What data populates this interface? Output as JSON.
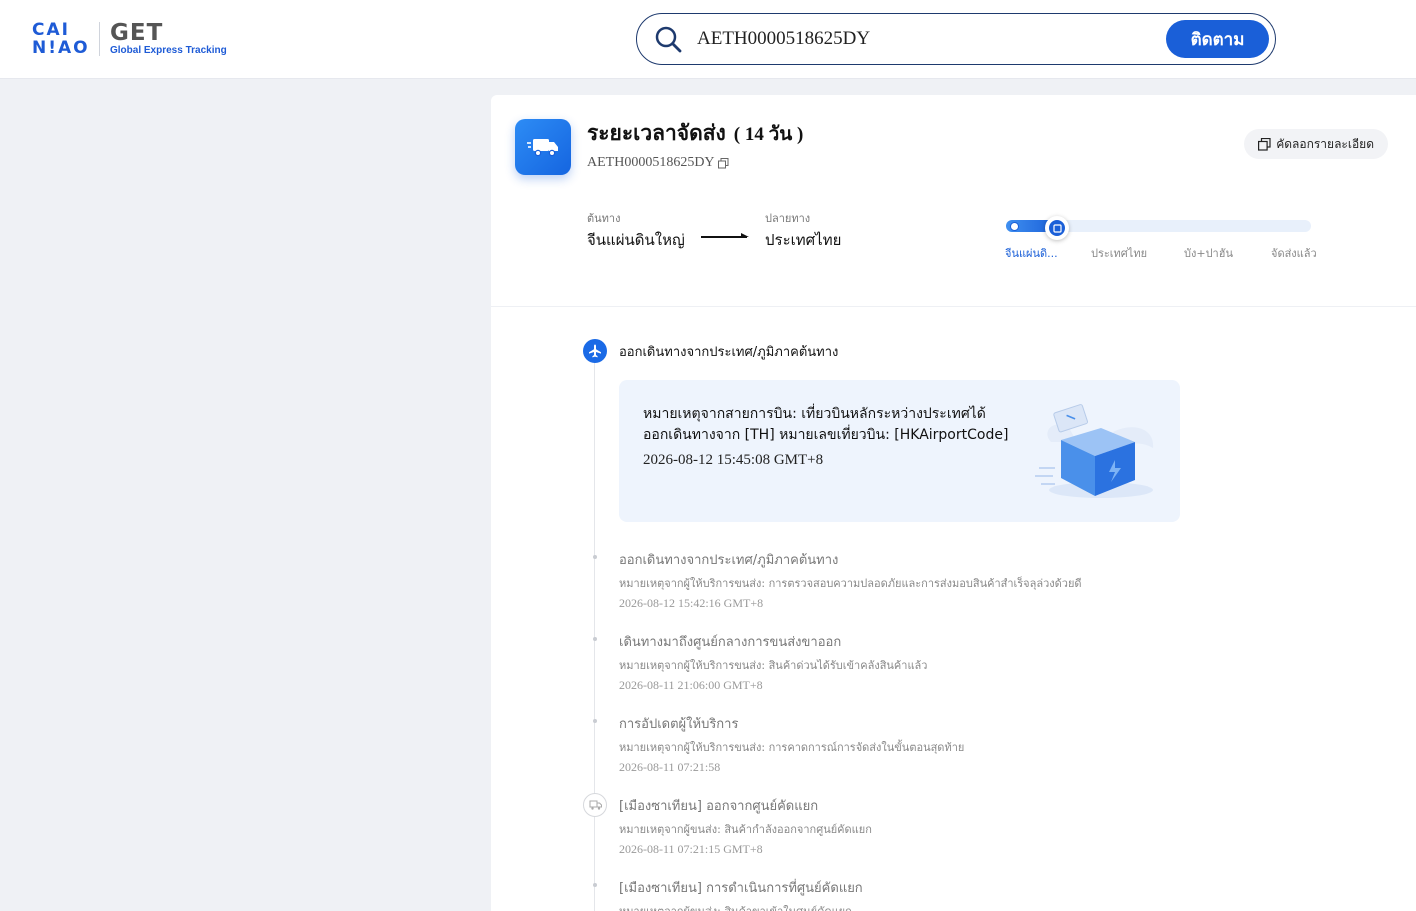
{
  "header": {
    "logo_cainiao": "CAI N!AO",
    "logo_get": "GET",
    "logo_sub": "Global Express Tracking",
    "search_value": "AETH0000518625DY",
    "search_button": "ติดตาม"
  },
  "summary": {
    "title": "ระยะเวลาจัดส่ง",
    "duration": "( 14 วัน )",
    "tracking_number": "AETH0000518625DY",
    "copy_label": "คัดลอกรายละเอียด",
    "origin_label": "ต้นทาง",
    "origin_value": "จีนแผ่นดินใหญ่",
    "dest_label": "ปลายทาง",
    "dest_value": "ประเทศไทย",
    "progress_fraction": 0.17,
    "stages": [
      "จีนแผ่นดิ...",
      "ประเทศไทย",
      "บัง+ปาฮัน",
      "จัดส่งแล้ว"
    ]
  },
  "timeline": {
    "latest": {
      "title": "ออกเดินทางจากประเทศ/ภูมิภาคต้นทาง",
      "desc_line1": "หมายเหตุจากสายการบิน: เที่ยวบินหลักระหว่างประเทศได้",
      "desc_line2": "ออกเดินทางจาก [TH] หมายเลขเที่ยวบิน: [HKAirportCode]",
      "time": "2026-08-12 15:45:08 GMT+8"
    },
    "events": [
      {
        "title": "ออกเดินทางจากประเทศ/ภูมิภาคต้นทาง",
        "note": "หมายเหตุจากผู้ให้บริการขนส่ง: การตรวจสอบความปลอดภัยและการส่งมอบสินค้าสำเร็จลุล่วงด้วยดี",
        "time": "2026-08-12 15:42:16 GMT+8"
      },
      {
        "title": "เดินทางมาถึงศูนย์กลางการขนส่งขาออก",
        "note": "หมายเหตุจากผู้ให้บริการขนส่ง: สินค้าด่วนได้รับเข้าคลังสินค้าแล้ว",
        "time": "2026-08-11 21:06:00 GMT+8"
      },
      {
        "title": "การอัปเดตผู้ให้บริการ",
        "note": "หมายเหตุจากผู้ให้บริการขนส่ง: การคาดการณ์การจัดส่งในขั้นตอนสุดท้าย",
        "time": "2026-08-11 07:21:58"
      },
      {
        "title": "[เมืองซาเทียน] ออกจากศูนย์คัดแยก",
        "note": "หมายเหตุจากผู้ขนส่ง: สินค้ากำลังออกจากศูนย์คัดแยก",
        "time": "2026-08-11 07:21:15 GMT+8"
      },
      {
        "title": "[เมืองซาเทียน] การดำเนินการที่ศูนย์คัดแยก",
        "note": "หมายเหตุจากผู้ขนส่ง: สินค้าขาเข้าในศูนย์คัดแยก",
        "time": ""
      }
    ]
  },
  "colors": {
    "brand_blue": "#1a5fd8",
    "page_bg": "#eff1f5",
    "event_box_bg": "#eef4fd"
  }
}
